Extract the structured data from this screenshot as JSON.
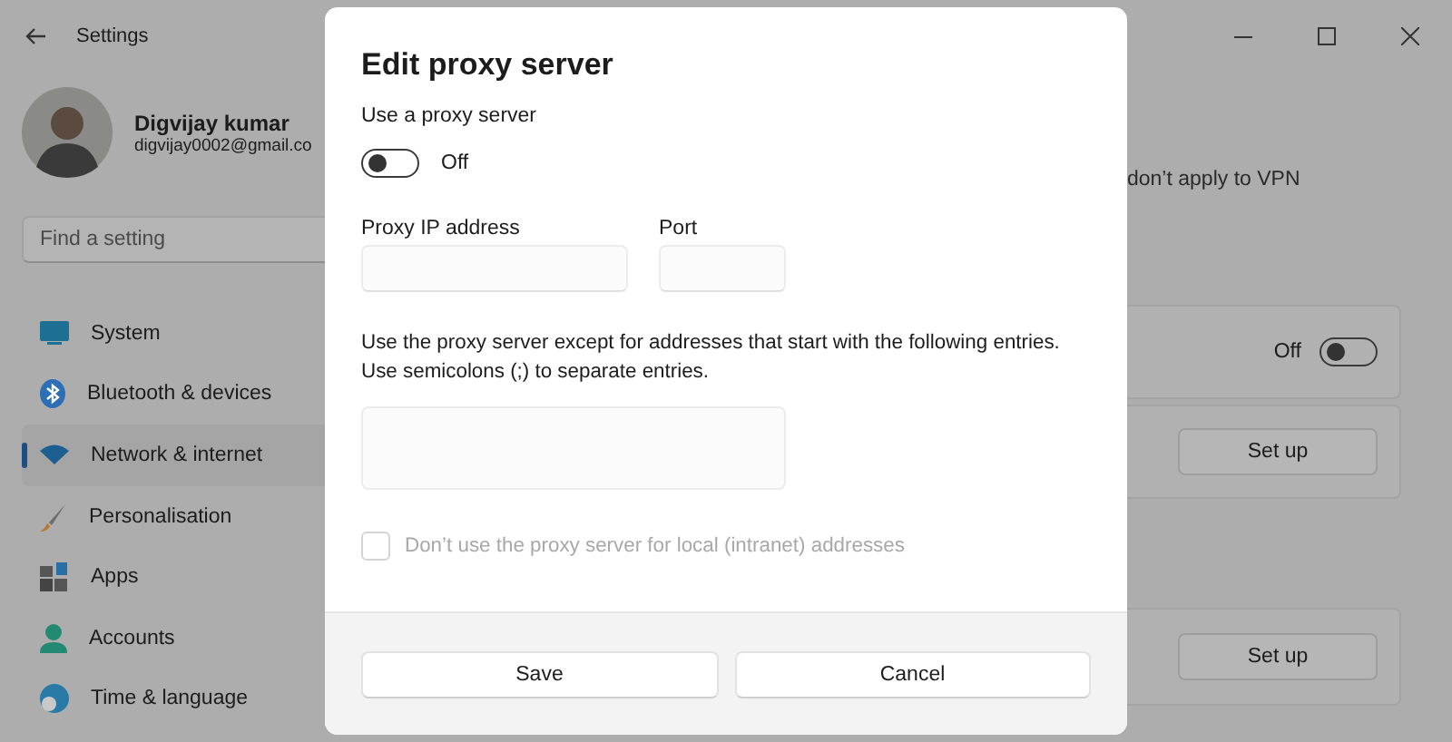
{
  "window": {
    "title": "Settings"
  },
  "account": {
    "name": "Digvijay kumar",
    "email": "digvijay0002@gmail.co"
  },
  "search": {
    "placeholder": "Find a setting"
  },
  "nav": [
    {
      "label": "System",
      "selected": false
    },
    {
      "label": "Bluetooth & devices",
      "selected": false
    },
    {
      "label": "Network & internet",
      "selected": true
    },
    {
      "label": "Personalisation",
      "selected": false
    },
    {
      "label": "Apps",
      "selected": false
    },
    {
      "label": "Accounts",
      "selected": false
    },
    {
      "label": "Time & language",
      "selected": false
    }
  ],
  "page": {
    "note": "don’t apply to VPN",
    "rows": [
      {
        "kind": "toggle",
        "state_label": "Off",
        "on": false
      },
      {
        "kind": "button",
        "button": "Set up"
      },
      {
        "kind": "button",
        "button": "Set up"
      }
    ]
  },
  "dialog": {
    "title": "Edit proxy server",
    "use_proxy": {
      "label": "Use a proxy server",
      "on": false,
      "state_label": "Off"
    },
    "proxy_ip": {
      "label": "Proxy IP address"
    },
    "port": {
      "label": "Port"
    },
    "exceptions": {
      "lines": [
        "Use the proxy server except for addresses that start with the following entries.",
        "Use semicolons (;) to separate entries."
      ]
    },
    "local_checkbox": {
      "label": "Don’t use the proxy server for local (intranet) addresses",
      "checked": false,
      "disabled": true
    },
    "buttons": [
      "Save",
      "Cancel"
    ]
  }
}
